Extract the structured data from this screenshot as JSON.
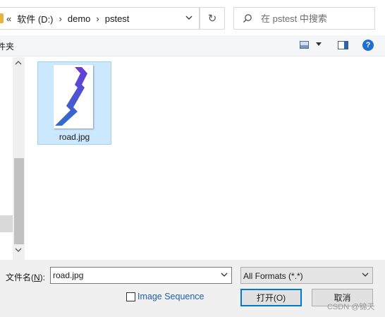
{
  "address": {
    "overflow": "«",
    "crumbs": [
      "软件 (D:)",
      "demo",
      "pstest"
    ],
    "separator": "›"
  },
  "search": {
    "placeholder": "在 pstest 中搜索"
  },
  "toolbar": {
    "new_folder_partial": "件夹"
  },
  "files": [
    {
      "name": "road.jpg",
      "selected": true
    }
  ],
  "bottom": {
    "filename_label_prefix": "文件名(",
    "filename_label_key": "N",
    "filename_label_suffix": "):",
    "filename_value": "road.jpg",
    "format_value": "All Formats (*.*)",
    "image_sequence_label": "Image Sequence",
    "open_label": "打开(O)",
    "cancel_label": "取消"
  },
  "watermark": "CSDN @锦天",
  "colors": {
    "selection_bg": "#cce8ff",
    "selection_border": "#99d1ff",
    "accent": "#0078d7",
    "folder": "#e8b33e"
  }
}
